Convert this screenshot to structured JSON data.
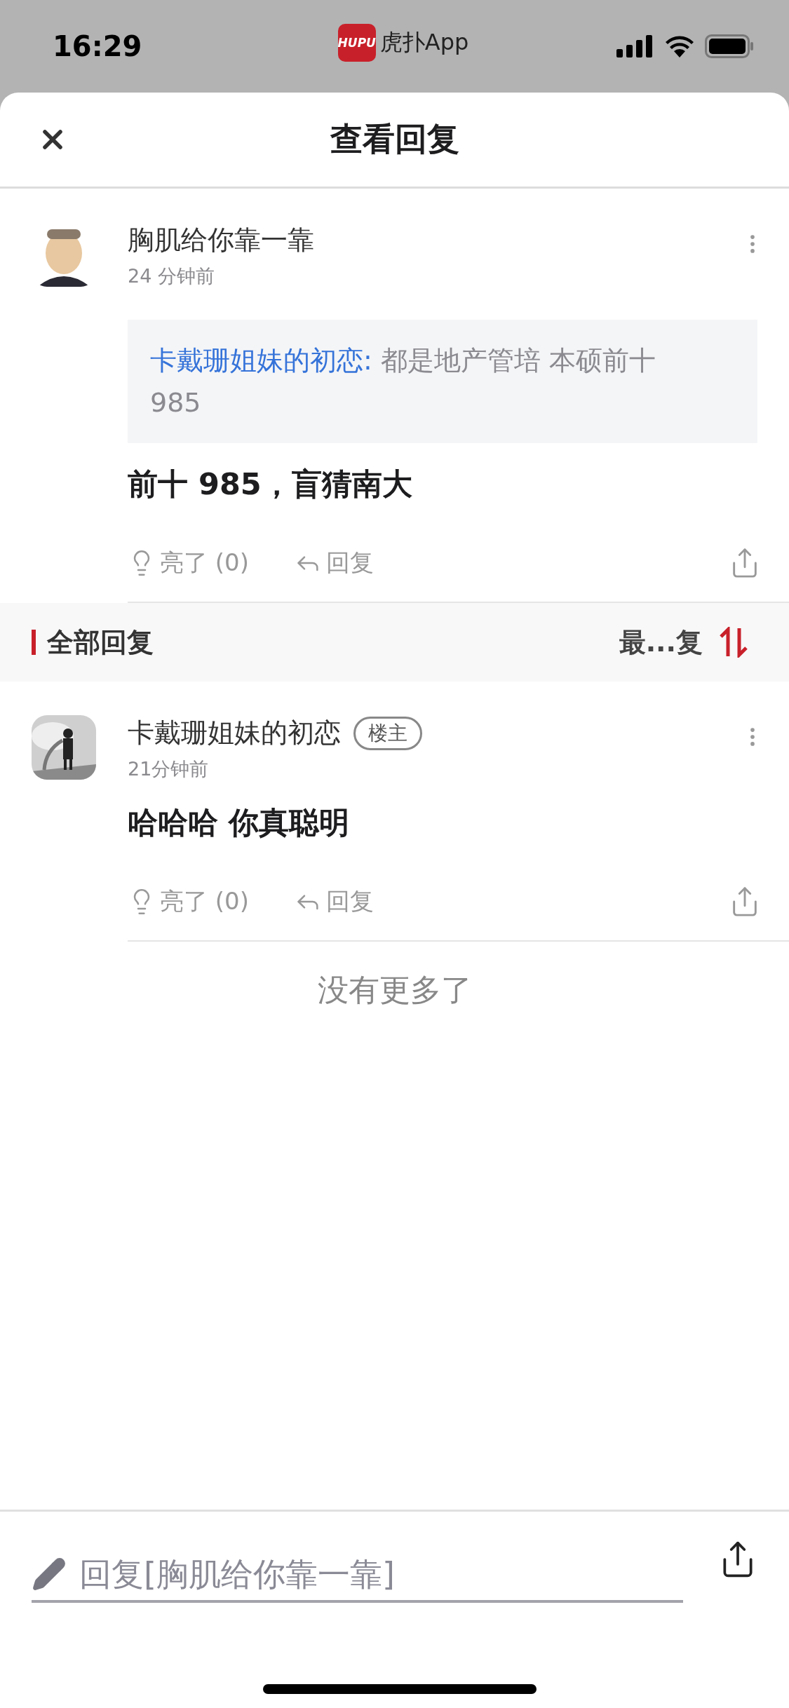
{
  "status_bar": {
    "time": "16:29",
    "app_badge": "HUPU",
    "app_name": "虎扑App"
  },
  "header": {
    "title": "查看回复"
  },
  "reply": {
    "author": "胸肌给你靠一靠",
    "time": "24 分钟前",
    "quote": {
      "author": "卡戴珊姐妹的初恋:",
      "text": "都是地产管培 本硕前十985"
    },
    "body": "前十 985，盲猜南大",
    "like": "亮了 (0)",
    "reply": "回复"
  },
  "section": {
    "title": "全部回复",
    "sort": "最...复"
  },
  "replies": [
    {
      "author": "卡戴珊姐妹的初恋",
      "badge": "楼主",
      "time": "21分钟前",
      "body": "哈哈哈 你真聪明",
      "like": "亮了 (0)",
      "reply": "回复"
    }
  ],
  "end_text": "没有更多了",
  "composer": {
    "placeholder": "回复[胸肌给你靠一靠]"
  }
}
